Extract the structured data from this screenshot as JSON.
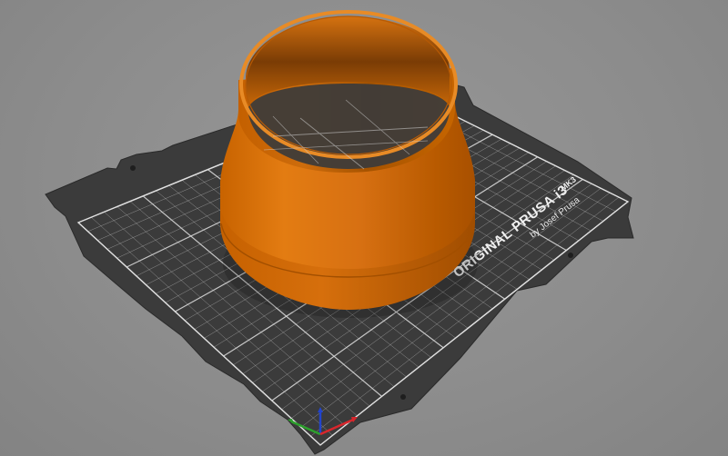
{
  "app": {
    "view": "3D plater view"
  },
  "bed": {
    "brand_line_1": "ORIGINAL PRUSA i3",
    "brand_model": "MK3",
    "brand_line_2": "by Josef Prusa"
  },
  "colors": {
    "background": "#8d8d8d",
    "bed_surface": "#3c3c3c",
    "grid_line": "#d8d8d8",
    "object": "#e07a10",
    "axis_x": "#d9262c",
    "axis_y": "#2ca02c",
    "axis_z": "#2244cc"
  },
  "object": {
    "shape": "cylindrical reducer / funnel"
  },
  "icons": {
    "axes": "axes-gizmo-icon"
  }
}
